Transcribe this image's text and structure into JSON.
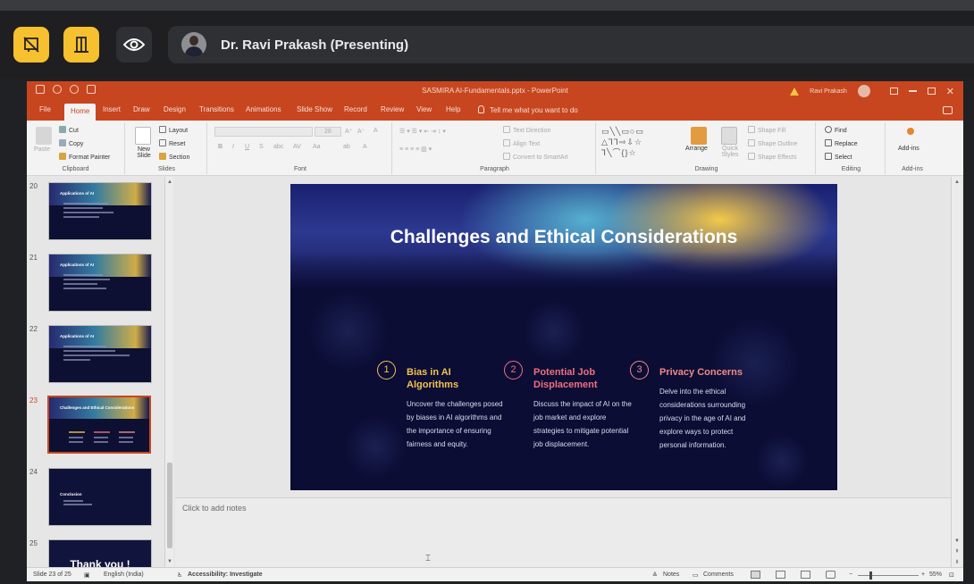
{
  "meeting": {
    "presenter": "Dr. Ravi Prakash (Presenting)",
    "colors": {
      "accent": "#f6c02f",
      "bar": "#1f1f21",
      "pill": "#2f3033"
    }
  },
  "ppt": {
    "window_title": "SASMIRA AI-Fundamentals.pptx - PowerPoint",
    "user": "Ravi Prakash",
    "tabs": [
      "File",
      "Home",
      "Insert",
      "Draw",
      "Design",
      "Transitions",
      "Animations",
      "Slide Show",
      "Record",
      "Review",
      "View",
      "Help"
    ],
    "active_tab": "Home",
    "tell_me": "Tell me what you want to do",
    "ribbon": {
      "clipboard": {
        "paste": "Paste",
        "cut": "Cut",
        "copy": "Copy",
        "format_painter": "Format Painter",
        "label": "Clipboard"
      },
      "slides": {
        "new_slide": "New Slide",
        "layout": "Layout",
        "reset": "Reset",
        "section": "Section",
        "label": "Slides"
      },
      "font": {
        "label": "Font",
        "size": "28",
        "bold": "B",
        "italic": "I",
        "underline": "U",
        "strike": "S",
        "shadow": "abc",
        "spacing": "AV",
        "case": "Aa",
        "color": "A"
      },
      "paragraph": {
        "label": "Paragraph",
        "text_direction": "Text Direction",
        "align_text": "Align Text",
        "smartart": "Convert to SmartArt"
      },
      "drawing": {
        "label": "Drawing",
        "arrange": "Arrange",
        "quick_styles": "Quick Styles",
        "shape_fill": "Shape Fill",
        "shape_outline": "Shape Outline",
        "shape_effects": "Shape Effects"
      },
      "editing": {
        "label": "Editing",
        "find": "Find",
        "replace": "Replace",
        "select": "Select"
      },
      "addins": {
        "label": "Add-ins",
        "addins": "Add-ins"
      }
    },
    "thumbnails": [
      {
        "num": "20",
        "title": "Applications of AI",
        "selected": false
      },
      {
        "num": "21",
        "title": "Applications of AI",
        "selected": false
      },
      {
        "num": "22",
        "title": "Applications of AI",
        "selected": false
      },
      {
        "num": "23",
        "title": "Challenges and Ethical Considerations",
        "selected": true
      },
      {
        "num": "24",
        "title": "Conclusion",
        "selected": false
      },
      {
        "num": "25",
        "title": "Thank you !",
        "selected": false
      }
    ],
    "slide": {
      "title": "Challenges and Ethical Considerations",
      "columns": [
        {
          "num": "1",
          "heading": "Bias in AI Algorithms",
          "body": "Uncover the challenges posed by biases in AI algorithms and the importance of ensuring fairness and equity.",
          "color": "#f2c14e"
        },
        {
          "num": "2",
          "heading": "Potential Job Displacement",
          "body": "Discuss the impact of AI on the job market and explore strategies to mitigate potential job displacement.",
          "color": "#ef6f7e"
        },
        {
          "num": "3",
          "heading": "Privacy Concerns",
          "body": "Delve into the ethical considerations surrounding privacy in the age of AI and explore ways to protect personal information.",
          "color": "#ef8a86"
        }
      ]
    },
    "notes_placeholder": "Click to add notes",
    "status": {
      "slide_of": "Slide 23 of 25",
      "language": "English (India)",
      "accessibility": "Accessibility: Investigate",
      "notes": "Notes",
      "comments": "Comments",
      "zoom": "55%"
    }
  }
}
